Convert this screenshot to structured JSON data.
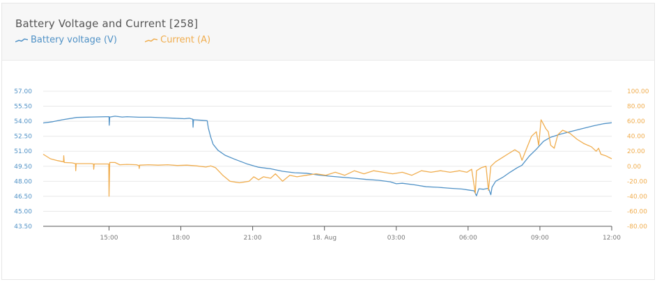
{
  "title": "Battery Voltage and Current [258]",
  "colors": {
    "voltage": "#4f91c6",
    "current": "#f0ad4e",
    "grid": "#e8e8e8",
    "axis": "#555555",
    "xtext": "#777777"
  },
  "chart_data": {
    "type": "line",
    "title": "Battery Voltage and Current [258]",
    "legend_placement": "top-left",
    "grid": true,
    "x_axis": {
      "type": "time",
      "range": [
        "2017-08-17 12:15",
        "2017-08-18 12:00"
      ],
      "ticks": [
        {
          "t": 2.75,
          "label": "15:00"
        },
        {
          "t": 5.75,
          "label": "18:00"
        },
        {
          "t": 8.75,
          "label": "21:00"
        },
        {
          "t": 11.75,
          "label": "18. Aug"
        },
        {
          "t": 14.75,
          "label": "03:00"
        },
        {
          "t": 17.75,
          "label": "06:00"
        },
        {
          "t": 20.75,
          "label": "09:00"
        },
        {
          "t": 23.75,
          "label": "12:00"
        }
      ]
    },
    "y_left": {
      "name": "Battery voltage (V)",
      "min": 43.5,
      "max": 57.0,
      "ticks": [
        "57.00",
        "55.50",
        "54.00",
        "52.50",
        "51.00",
        "49.50",
        "48.00",
        "46.50",
        "45.00",
        "43.50"
      ]
    },
    "y_right": {
      "name": "Current (A)",
      "min": -80,
      "max": 100,
      "ticks": [
        "100.00",
        "80.00",
        "60.00",
        "40.00",
        "20.00",
        "0.00",
        "-20.00",
        "-40.00",
        "-60.00",
        "-80.00"
      ]
    },
    "series": [
      {
        "name": "Battery voltage (V)",
        "axis": "left",
        "points": [
          [
            0,
            53.83
          ],
          [
            0.4,
            53.95
          ],
          [
            0.8,
            54.15
          ],
          [
            1.4,
            54.38
          ],
          [
            2.0,
            54.42
          ],
          [
            2.6,
            54.45
          ],
          [
            2.75,
            54.45
          ],
          [
            2.76,
            53.6
          ],
          [
            2.78,
            54.42
          ],
          [
            3.0,
            54.5
          ],
          [
            3.3,
            54.42
          ],
          [
            3.5,
            54.45
          ],
          [
            4.0,
            54.4
          ],
          [
            4.5,
            54.4
          ],
          [
            5.0,
            54.35
          ],
          [
            5.5,
            54.3
          ],
          [
            5.9,
            54.25
          ],
          [
            6.1,
            54.3
          ],
          [
            6.25,
            54.2
          ],
          [
            6.26,
            53.4
          ],
          [
            6.28,
            54.15
          ],
          [
            6.6,
            54.1
          ],
          [
            6.85,
            54.05
          ],
          [
            6.9,
            53.3
          ],
          [
            7.0,
            52.4
          ],
          [
            7.1,
            51.7
          ],
          [
            7.3,
            51.1
          ],
          [
            7.6,
            50.6
          ],
          [
            8.0,
            50.2
          ],
          [
            8.5,
            49.75
          ],
          [
            9.0,
            49.4
          ],
          [
            9.5,
            49.25
          ],
          [
            10.0,
            49.0
          ],
          [
            10.5,
            48.85
          ],
          [
            11.0,
            48.8
          ],
          [
            11.5,
            48.62
          ],
          [
            12.0,
            48.5
          ],
          [
            12.5,
            48.4
          ],
          [
            13.0,
            48.3
          ],
          [
            13.5,
            48.18
          ],
          [
            14.0,
            48.1
          ],
          [
            14.5,
            47.95
          ],
          [
            14.75,
            47.75
          ],
          [
            15.0,
            47.8
          ],
          [
            15.5,
            47.65
          ],
          [
            16.0,
            47.45
          ],
          [
            16.5,
            47.4
          ],
          [
            17.0,
            47.3
          ],
          [
            17.5,
            47.22
          ],
          [
            17.85,
            47.1
          ],
          [
            18.0,
            47.05
          ],
          [
            18.1,
            46.55
          ],
          [
            18.2,
            47.25
          ],
          [
            18.4,
            47.2
          ],
          [
            18.6,
            47.3
          ],
          [
            18.7,
            46.65
          ],
          [
            18.75,
            47.4
          ],
          [
            18.9,
            48.0
          ],
          [
            19.2,
            48.4
          ],
          [
            19.5,
            48.9
          ],
          [
            19.8,
            49.35
          ],
          [
            20.0,
            49.6
          ],
          [
            20.3,
            50.5
          ],
          [
            20.6,
            51.2
          ],
          [
            20.9,
            52.0
          ],
          [
            21.2,
            52.4
          ],
          [
            21.6,
            52.7
          ],
          [
            22.0,
            52.95
          ],
          [
            22.5,
            53.25
          ],
          [
            23.0,
            53.55
          ],
          [
            23.4,
            53.75
          ],
          [
            23.75,
            53.85
          ]
        ]
      },
      {
        "name": "Current (A)",
        "axis": "right",
        "points": [
          [
            0,
            16.0
          ],
          [
            0.3,
            10.0
          ],
          [
            0.6,
            7.5
          ],
          [
            0.85,
            6.0
          ],
          [
            0.86,
            14.0
          ],
          [
            0.88,
            5.0
          ],
          [
            1.2,
            4.5
          ],
          [
            1.35,
            3.5
          ],
          [
            1.36,
            -6.0
          ],
          [
            1.38,
            3.5
          ],
          [
            1.7,
            3.5
          ],
          [
            2.0,
            3.5
          ],
          [
            2.1,
            3.0
          ],
          [
            2.11,
            -4.0
          ],
          [
            2.13,
            3.0
          ],
          [
            2.5,
            3.0
          ],
          [
            2.74,
            3.0
          ],
          [
            2.75,
            -40.0
          ],
          [
            2.78,
            5.0
          ],
          [
            3.0,
            5.0
          ],
          [
            3.2,
            2.0
          ],
          [
            3.5,
            2.5
          ],
          [
            3.9,
            2.0
          ],
          [
            4.0,
            1.0
          ],
          [
            4.01,
            -3.0
          ],
          [
            4.03,
            1.5
          ],
          [
            4.4,
            2.0
          ],
          [
            4.8,
            1.5
          ],
          [
            5.2,
            2.0
          ],
          [
            5.6,
            1.0
          ],
          [
            6.0,
            1.5
          ],
          [
            6.4,
            0.5
          ],
          [
            6.8,
            -1.0
          ],
          [
            7.0,
            0.5
          ],
          [
            7.2,
            -2.0
          ],
          [
            7.5,
            -12.0
          ],
          [
            7.8,
            -20.0
          ],
          [
            8.2,
            -22.0
          ],
          [
            8.6,
            -20.0
          ],
          [
            8.8,
            -14.0
          ],
          [
            9.0,
            -18.0
          ],
          [
            9.2,
            -14.0
          ],
          [
            9.5,
            -16.0
          ],
          [
            9.7,
            -10.0
          ],
          [
            10.0,
            -20.0
          ],
          [
            10.3,
            -12.0
          ],
          [
            10.6,
            -14.0
          ],
          [
            11.0,
            -12.0
          ],
          [
            11.4,
            -10.0
          ],
          [
            11.8,
            -12.0
          ],
          [
            12.2,
            -8.0
          ],
          [
            12.6,
            -12.0
          ],
          [
            13.0,
            -6.0
          ],
          [
            13.4,
            -10.0
          ],
          [
            13.8,
            -6.0
          ],
          [
            14.2,
            -8.0
          ],
          [
            14.6,
            -10.0
          ],
          [
            15.0,
            -8.0
          ],
          [
            15.4,
            -12.0
          ],
          [
            15.8,
            -6.0
          ],
          [
            16.2,
            -8.0
          ],
          [
            16.6,
            -6.0
          ],
          [
            17.0,
            -8.0
          ],
          [
            17.4,
            -6.0
          ],
          [
            17.7,
            -8.0
          ],
          [
            17.9,
            -4.0
          ],
          [
            18.05,
            -36.0
          ],
          [
            18.1,
            -6.0
          ],
          [
            18.3,
            -2.0
          ],
          [
            18.5,
            0.0
          ],
          [
            18.6,
            -32.0
          ],
          [
            18.7,
            0.0
          ],
          [
            18.9,
            6.0
          ],
          [
            19.2,
            12.0
          ],
          [
            19.4,
            16.0
          ],
          [
            19.7,
            22.0
          ],
          [
            19.9,
            18.0
          ],
          [
            20.0,
            8.0
          ],
          [
            20.2,
            24.0
          ],
          [
            20.4,
            40.0
          ],
          [
            20.6,
            46.0
          ],
          [
            20.7,
            28.0
          ],
          [
            20.8,
            62.0
          ],
          [
            20.9,
            56.0
          ],
          [
            21.0,
            50.0
          ],
          [
            21.1,
            46.0
          ],
          [
            21.2,
            28.0
          ],
          [
            21.35,
            24.0
          ],
          [
            21.5,
            42.0
          ],
          [
            21.7,
            48.0
          ],
          [
            22.0,
            44.0
          ],
          [
            22.3,
            36.0
          ],
          [
            22.6,
            30.0
          ],
          [
            22.9,
            26.0
          ],
          [
            23.1,
            20.0
          ],
          [
            23.2,
            24.0
          ],
          [
            23.3,
            16.0
          ],
          [
            23.5,
            14.0
          ],
          [
            23.75,
            10.0
          ]
        ]
      }
    ]
  }
}
